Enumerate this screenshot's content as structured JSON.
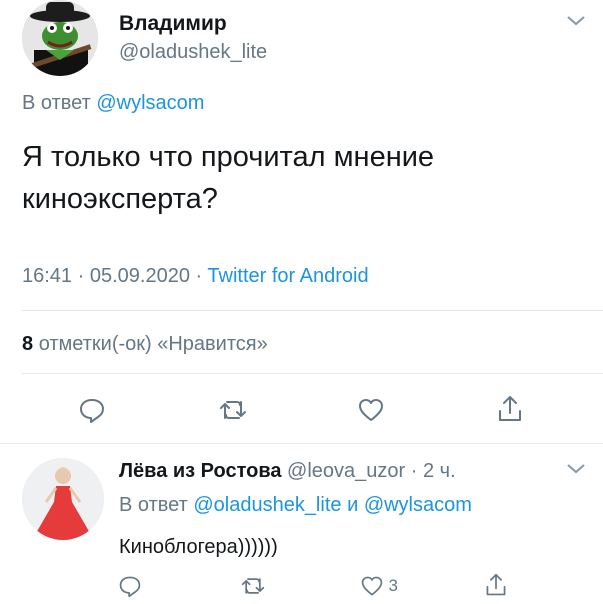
{
  "tweet": {
    "author_name": "Владимир",
    "author_handle": "@oladushek_lite",
    "reply_prefix": "В ответ",
    "reply_to": "@wylsacom",
    "text": "Я только что прочитал мнение киноэксперта?",
    "time": "16:41",
    "date": "05.09.2020",
    "source": "Twitter for Android",
    "meta_sep": "·",
    "likes_count": "8",
    "likes_label": "отметки(-ок) «Нравится»"
  },
  "reply": {
    "author_name": "Лёва из Ростова",
    "author_handle": "@leova_uzor",
    "time_ago": "2 ч.",
    "reply_prefix": "В ответ",
    "reply_to_1": "@oladushek_lite",
    "conj": "и",
    "reply_to_2": "@wylsacom",
    "text": "Киноблогера))))))",
    "like_count": "3"
  },
  "colors": {
    "link": "#1b95e0",
    "muted": "#657786",
    "text": "#14171a",
    "divider": "#e1e8ed"
  },
  "icons": [
    "chevron-down-icon",
    "reply-icon",
    "retweet-icon",
    "like-icon",
    "share-icon"
  ]
}
